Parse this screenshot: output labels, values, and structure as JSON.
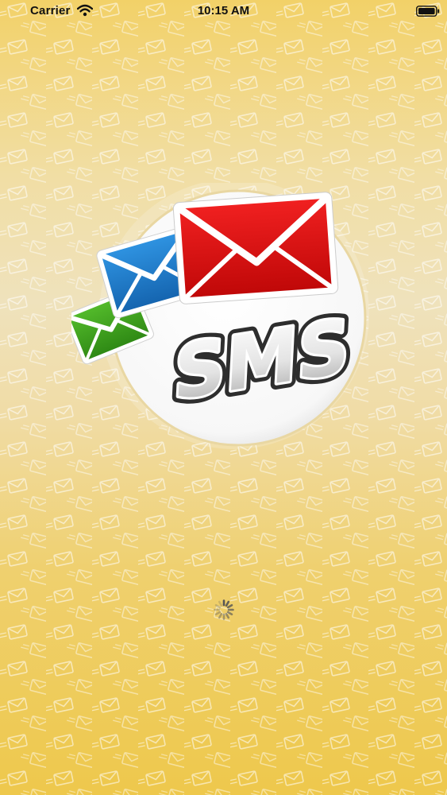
{
  "status_bar": {
    "carrier": "Carrier",
    "time": "10:15 AM",
    "icons": [
      "wifi-icon",
      "battery-icon"
    ]
  },
  "logo": {
    "text": "SMS",
    "icons": [
      "red-envelope-icon",
      "blue-envelope-icon",
      "green-envelope-icon"
    ],
    "colors": {
      "red": "#E01010",
      "blue": "#1E7FD0",
      "green": "#3FA21F",
      "circle": "#FFFFFF"
    }
  },
  "loading": {
    "icon": "loading-spinner-icon"
  },
  "background": {
    "pattern_icon": "envelope-pattern-icon",
    "colors": {
      "top": "#F2D168",
      "middle": "#EFE2BC",
      "bottom": "#EEC84C"
    }
  }
}
